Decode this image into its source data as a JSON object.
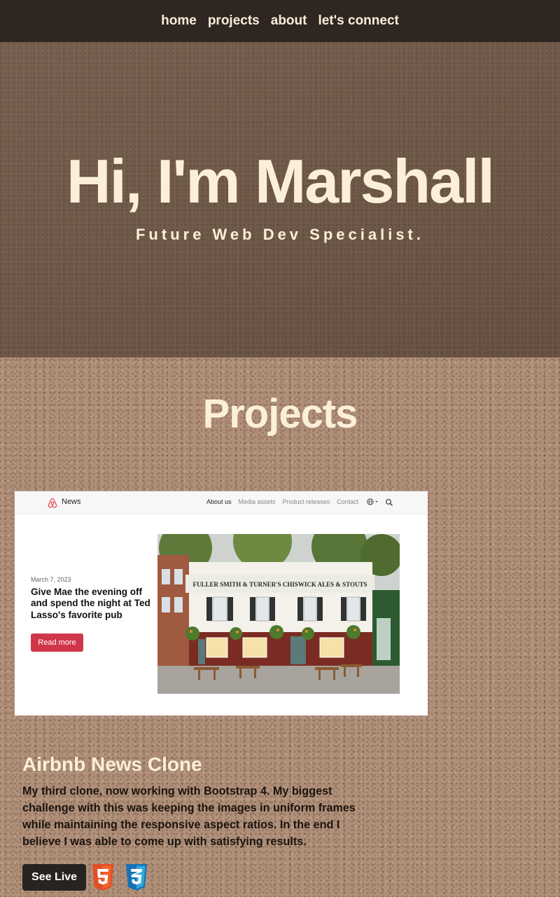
{
  "nav": {
    "items": [
      {
        "label": "home"
      },
      {
        "label": "projects"
      },
      {
        "label": "about"
      },
      {
        "label": "let's connect"
      }
    ]
  },
  "hero": {
    "title": "Hi, I'm Marshall",
    "subtitle": "Future Web Dev Specialist."
  },
  "projects": {
    "heading": "Projects",
    "items": [
      {
        "preview": {
          "brand": "News",
          "nav_links": [
            "About us",
            "Media assets",
            "Product releases",
            "Contact"
          ],
          "date": "March 7, 2023",
          "headline": "Give Mae the evening off and spend the night at Ted Lasso's favorite pub",
          "cta": "Read more",
          "sign_text": "FULLER SMITH & TURNER'S CHISWICK ALES & STOUTS"
        },
        "title": "Airbnb News Clone",
        "description": "My third clone, now working with Bootstrap 4. My biggest challenge with this was keeping the images in uniform frames while maintaining the responsive aspect ratios. In the end I believe I was able to come up with satisfying results.",
        "button_label": "See Live",
        "tech_icons": [
          "html5-icon",
          "css3-icon"
        ]
      }
    ]
  },
  "colors": {
    "nav_bg": "#2f2622",
    "hero_bg": "#6f5746",
    "page_bg": "#b08f78",
    "text_cream": "#fbefd9",
    "button_dark": "#272320",
    "preview_accent": "#d0364a",
    "html_orange": "#e44d26",
    "css_blue": "#1572b6"
  }
}
